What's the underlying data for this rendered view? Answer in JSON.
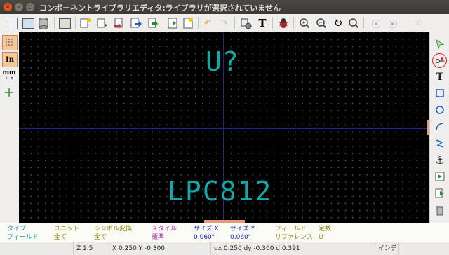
{
  "window": {
    "title": "コンポーネントライブラリエディタ:ライブラリが選択されていません"
  },
  "canvas": {
    "reference": "U?",
    "value": "LPC812"
  },
  "left_toolbar": {
    "units_inch": "In",
    "units_mm": "mm"
  },
  "info": {
    "type": {
      "label": "タイプ",
      "value": "フィールド"
    },
    "unit": {
      "label": "ユニット",
      "value": "全て"
    },
    "convert": {
      "label": "シンボル変換",
      "value": "全て"
    },
    "style": {
      "label": "スタイル",
      "value": "標準"
    },
    "size_x": {
      "label": "サイズ X",
      "value": "0.060\""
    },
    "size_y": {
      "label": "サイズ Y",
      "value": "0.060\""
    },
    "field": {
      "label": "フィールド",
      "value": "リファレンス"
    },
    "constant": {
      "label": "定数",
      "value": "U"
    }
  },
  "status": {
    "zoom": "Z 1.5",
    "abs": "X 0.250  Y -0.300",
    "rel": "dx 0.250  dy -0.300  d 0.391",
    "units": "インチ"
  },
  "colors": {
    "canvas_bg": "#000000",
    "schematic_text": "#13a8a8",
    "axis": "#1a2a8c"
  }
}
